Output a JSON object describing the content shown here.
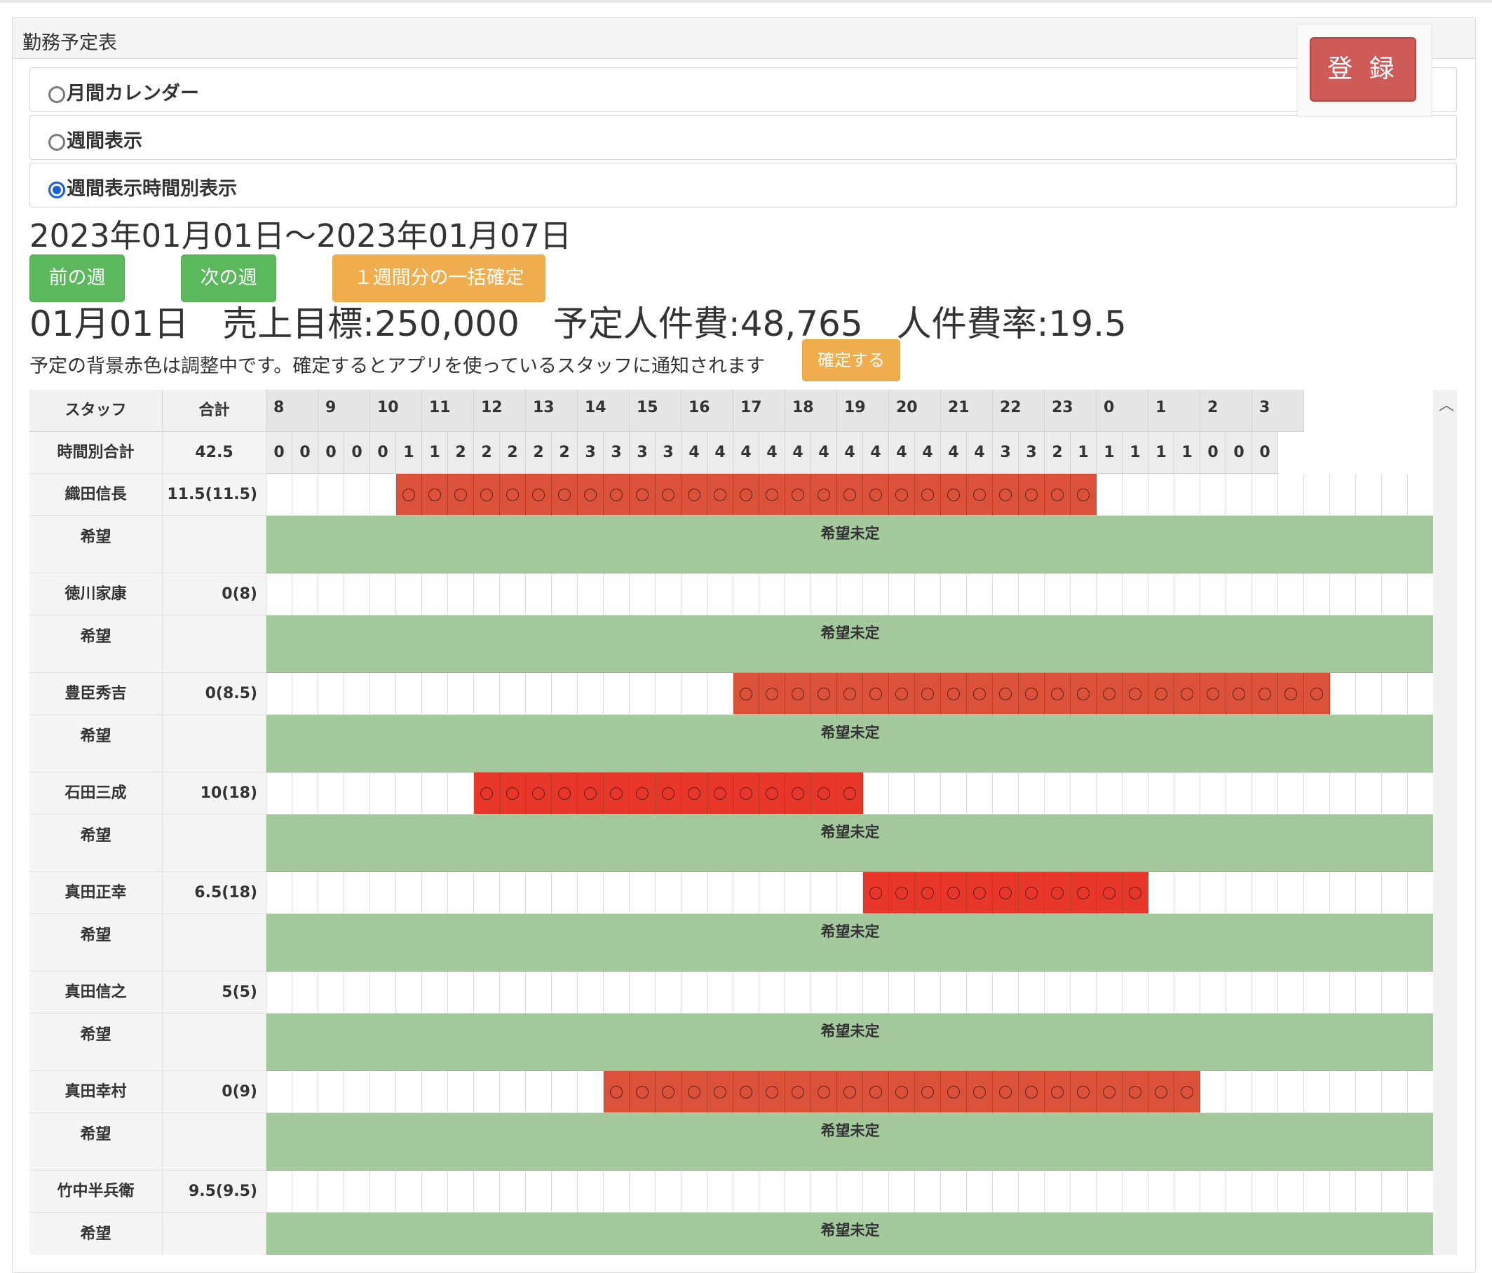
{
  "panel": {
    "title": "勤務予定表",
    "register_label": "登 録"
  },
  "view_options": [
    {
      "label": "月間カレンダー",
      "selected": false
    },
    {
      "label": "週間表示",
      "selected": false
    },
    {
      "label": "週間表示時間別表示",
      "selected": true
    }
  ],
  "date_range": "2023年01月01日～2023年01月07日",
  "buttons": {
    "prev_week": "前の週",
    "next_week": "次の週",
    "bulk_confirm": "１週間分の一括確定",
    "confirm": "確定する"
  },
  "summary": {
    "date": "01月01日",
    "sales_target": "売上目標:250,000",
    "planned_cost": "予定人件費:48,765",
    "cost_rate": "人件費率:19.5"
  },
  "notice": "予定の背景赤色は調整中です。確定するとアプリを使っているスタッフに通知されます",
  "schedule": {
    "col_staff": "スタッフ",
    "col_total": "合計",
    "hourly_total_label": "時間別合計",
    "hourly_total_value": "42.5",
    "hours": [
      "8",
      "9",
      "10",
      "11",
      "12",
      "13",
      "14",
      "15",
      "16",
      "17",
      "18",
      "19",
      "20",
      "21",
      "22",
      "23",
      "0",
      "1",
      "2",
      "3"
    ],
    "slot_counts": [
      "0",
      "0",
      "0",
      "0",
      "0",
      "1",
      "1",
      "2",
      "2",
      "2",
      "2",
      "2",
      "3",
      "3",
      "3",
      "3",
      "4",
      "4",
      "4",
      "4",
      "4",
      "4",
      "4",
      "4",
      "4",
      "4",
      "4",
      "4",
      "3",
      "3",
      "2",
      "1",
      "1",
      "1",
      "1",
      "1",
      "0",
      "0",
      "0"
    ],
    "slot_mark": "○",
    "wish_label": "希望",
    "wish_undecided": "希望未定",
    "staff": [
      {
        "name": "織田信長",
        "total": "11.5(11.5)",
        "start": 5,
        "end": 32
      },
      {
        "name": "徳川家康",
        "total": "0(8)",
        "start": null,
        "end": null
      },
      {
        "name": "豊臣秀吉",
        "total": "0(8.5)",
        "start": 18,
        "end": 41
      },
      {
        "name": "石田三成",
        "total": "10(18)",
        "start": 8,
        "end": 23
      },
      {
        "name": "真田正幸",
        "total": "6.5(18)",
        "start": 23,
        "end": 34
      },
      {
        "name": "真田信之",
        "total": "5(5)",
        "start": null,
        "end": null
      },
      {
        "name": "真田幸村",
        "total": "0(9)",
        "start": 13,
        "end": 36
      },
      {
        "name": "竹中半兵衛",
        "total": "9.5(9.5)",
        "start": null,
        "end": null
      }
    ]
  }
}
